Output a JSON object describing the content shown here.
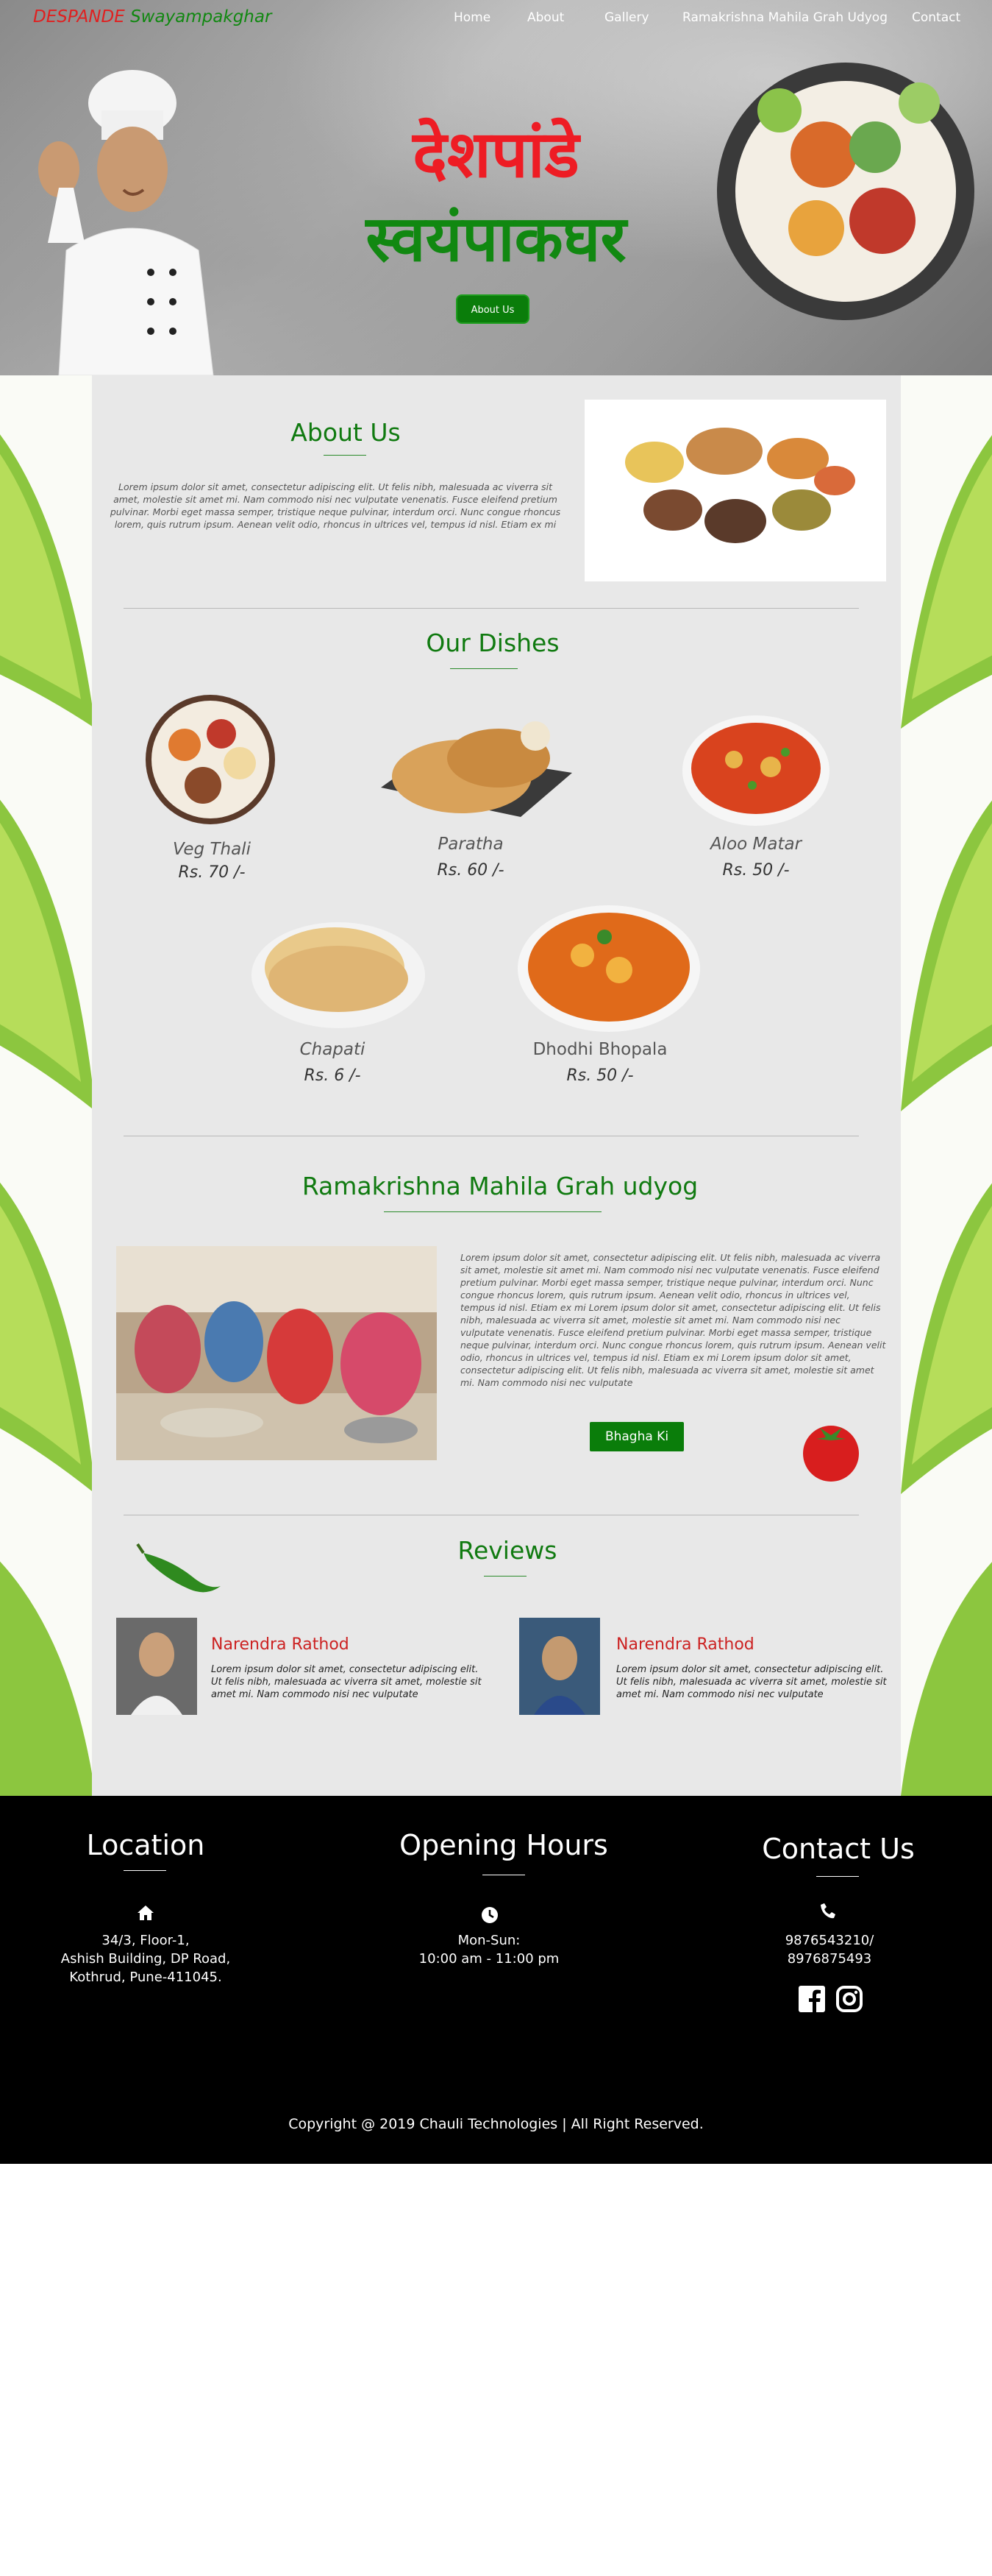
{
  "header": {
    "brand_part1": "DESPANDE",
    "brand_part2": "Swayampakghar",
    "nav": [
      "Home",
      "About",
      "Gallery",
      "Ramakrishna Mahila Grah Udyog",
      "Contact"
    ]
  },
  "hero": {
    "title_line1": "देशपांडे",
    "title_line2": "स्वयंपाकघर",
    "button_label": "About Us"
  },
  "about": {
    "title": "About Us",
    "text": "Lorem ipsum dolor sit amet, consectetur adipiscing elit. Ut felis nibh, malesuada ac viverra sit amet, molestie sit amet mi. Nam commodo nisi nec vulputate venenatis. Fusce eleifend pretium pulvinar. Morbi eget massa semper, tristique neque pulvinar, interdum orci. Nunc congue rhoncus lorem, quis rutrum ipsum. Aenean velit odio, rhoncus in ultrices vel, tempus id nisl. Etiam ex mi"
  },
  "dishes": {
    "title": "Our Dishes",
    "items": [
      {
        "name": "Veg Thali",
        "price": "Rs. 70 /-"
      },
      {
        "name": "Paratha",
        "price": "Rs. 60 /-"
      },
      {
        "name": "Aloo Matar",
        "price": "Rs. 50 /-"
      },
      {
        "name": "Chapati",
        "price": "Rs. 6 /-"
      },
      {
        "name": "Dhodhi Bhopala",
        "price": "Rs. 50 /-"
      }
    ]
  },
  "udyog": {
    "title": "Ramakrishna Mahila Grah udyog",
    "text": "Lorem ipsum dolor sit amet, consectetur adipiscing elit. Ut felis nibh, malesuada ac viverra sit amet, molestie sit amet mi. Nam commodo nisi nec vulputate venenatis. Fusce eleifend pretium pulvinar. Morbi eget massa semper, tristique neque pulvinar, interdum orci. Nunc congue rhoncus lorem, quis rutrum ipsum. Aenean velit odio, rhoncus in ultrices vel, tempus id nisl. Etiam ex mi Lorem ipsum dolor sit amet, consectetur adipiscing elit. Ut felis nibh, malesuada ac viverra sit amet, molestie sit amet mi. Nam commodo nisi nec vulputate venenatis. Fusce eleifend pretium pulvinar. Morbi eget massa semper, tristique neque pulvinar, interdum orci. Nunc congue rhoncus lorem, quis rutrum ipsum. Aenean velit odio, rhoncus in ultrices vel, tempus id nisl. Etiam ex mi Lorem ipsum dolor sit amet, consectetur adipiscing elit. Ut felis nibh, malesuada ac viverra sit amet, molestie sit amet mi. Nam commodo nisi nec vulputate",
    "button_label": "Bhagha Ki"
  },
  "reviews": {
    "title": "Reviews",
    "items": [
      {
        "name": "Narendra Rathod",
        "text": "Lorem ipsum dolor sit amet, consectetur adipiscing elit. Ut felis nibh, malesuada ac viverra sit amet, molestie sit amet mi. Nam commodo nisi nec vulputate"
      },
      {
        "name": "Narendra Rathod",
        "text": "Lorem ipsum dolor sit amet, consectetur adipiscing elit. Ut felis nibh, malesuada ac viverra sit amet, molestie sit amet mi. Nam commodo nisi nec vulputate"
      }
    ]
  },
  "footer": {
    "location_title": "Location",
    "address_line1": "34/3, Floor-1,",
    "address_line2": "Ashish Building, DP Road,",
    "address_line3": "Kothrud, Pune-411045.",
    "hours_title": "Opening Hours",
    "hours_days": "Mon-Sun:",
    "hours_time": "10:00 am - 11:00 pm",
    "contact_title": "Contact Us",
    "phone1": "9876543210/",
    "phone2": "8976875493",
    "copyright": "Copyright @ 2019 Chauli Technologies | All Right Reserved."
  },
  "icons": {
    "home": "home-icon",
    "clock": "clock-icon",
    "phone": "phone-icon",
    "facebook": "facebook-icon",
    "instagram": "instagram-icon"
  },
  "colors": {
    "brand_red": "#ee1c24",
    "brand_green": "#118811",
    "button_green": "#0a7d0a",
    "footer_bg": "#000000",
    "content_bg": "#e8e8e8"
  }
}
